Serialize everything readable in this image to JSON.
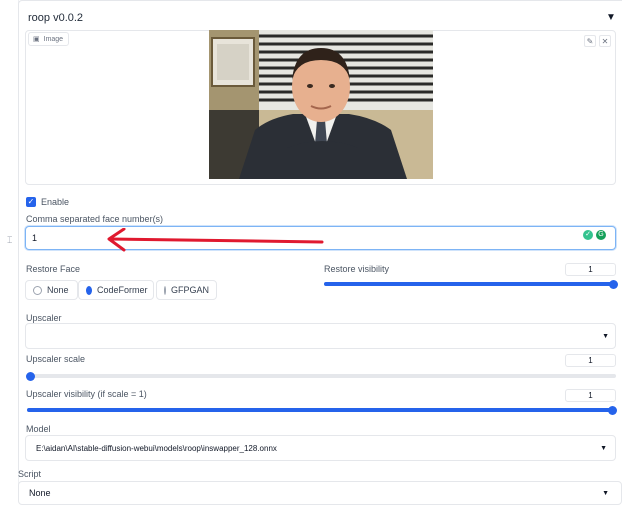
{
  "extension": {
    "title": "roop v0.0.2"
  },
  "image": {
    "label": "Image"
  },
  "enable": {
    "label": "Enable",
    "checked": true
  },
  "faces": {
    "label": "Comma separated face number(s)",
    "value": "1"
  },
  "restore_face": {
    "label": "Restore Face",
    "options": [
      "None",
      "CodeFormer",
      "GFPGAN"
    ],
    "selected": "CodeFormer"
  },
  "restore_visibility": {
    "label": "Restore visibility",
    "value": "1",
    "fraction": 1.0
  },
  "upscaler": {
    "label": "Upscaler",
    "value": ""
  },
  "upscaler_scale": {
    "label": "Upscaler scale",
    "value": "1",
    "fraction": 0.0
  },
  "upscaler_visibility": {
    "label": "Upscaler visibility (if scale = 1)",
    "value": "1",
    "fraction": 1.0
  },
  "model": {
    "label": "Model",
    "value": "E:\\aidan\\AI\\stable-diffusion-webui\\models\\roop\\inswapper_128.onnx"
  },
  "script": {
    "label": "Script",
    "value": "None"
  },
  "colors": {
    "accent": "#2563eb",
    "annotation": "#e0192f"
  }
}
